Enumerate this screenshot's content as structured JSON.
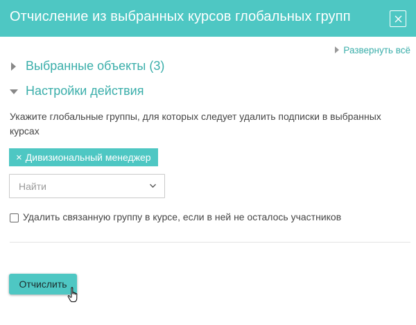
{
  "dialog": {
    "title": "Отчисление из выбранных курсов глобальных групп",
    "close_icon": "close-icon"
  },
  "expand_all": "Развернуть всё",
  "sections": [
    {
      "label": "Выбранные объекты (3)",
      "state": "collapsed"
    },
    {
      "label": "Настройки действия",
      "state": "expanded"
    }
  ],
  "settings": {
    "description": "Укажите глобальные группы, для которых следует удалить подписки в выбранных курсах",
    "selected_tag": "Дивизиональный менеджер",
    "search_placeholder": "Найти",
    "checkbox_label": "Удалить связанную группу в курсе, если в ней не осталось участников",
    "checkbox_checked": false
  },
  "submit_label": "Отчислить",
  "colors": {
    "accent": "#4ec7c3",
    "link": "#3aaeaa"
  }
}
